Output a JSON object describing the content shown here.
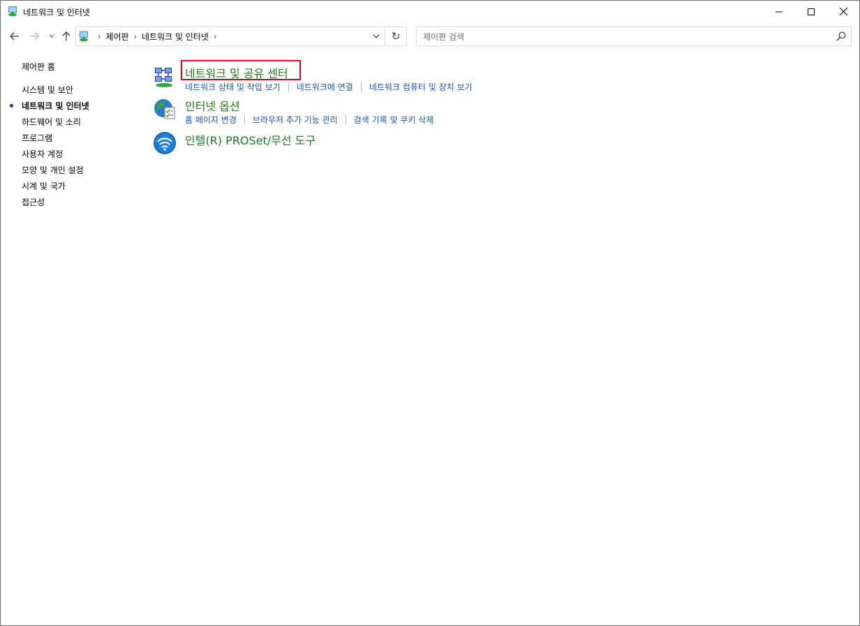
{
  "window": {
    "title": "네트워크 및 인터넷"
  },
  "navigation": {
    "breadcrumbs": [
      "제어판",
      "네트워크 및 인터넷"
    ],
    "search_placeholder": "제어판 검색"
  },
  "sidebar": {
    "home_label": "제어판 홈",
    "items": [
      {
        "label": "시스템 및 보안",
        "active": false
      },
      {
        "label": "네트워크 및 인터넷",
        "active": true
      },
      {
        "label": "하드웨어 및 소리",
        "active": false
      },
      {
        "label": "프로그램",
        "active": false
      },
      {
        "label": "사용자 계정",
        "active": false
      },
      {
        "label": "모양 및 개인 설정",
        "active": false
      },
      {
        "label": "시계 및 국가",
        "active": false
      },
      {
        "label": "접근성",
        "active": false
      }
    ]
  },
  "main": {
    "categories": [
      {
        "title": "네트워크 및 공유 센터",
        "icon": "network-sharing-center-icon",
        "links": [
          "네트워크 상태 및 작업 보기",
          "네트워크에 연결",
          "네트워크 컴퓨터 및 장치 보기"
        ]
      },
      {
        "title": "인터넷 옵션",
        "icon": "internet-options-icon",
        "links": [
          "홈 페이지 변경",
          "브라우저 추가 기능 관리",
          "검색 기록 및 쿠키 삭제"
        ]
      },
      {
        "title": "인텔(R) PROSet/무선 도구",
        "icon": "intel-wireless-icon",
        "links": []
      }
    ]
  },
  "colors": {
    "category_title": "#1e7c1e",
    "link": "#1a56b5",
    "highlight": "#e0001a",
    "active_bullet": "#1e3287"
  }
}
